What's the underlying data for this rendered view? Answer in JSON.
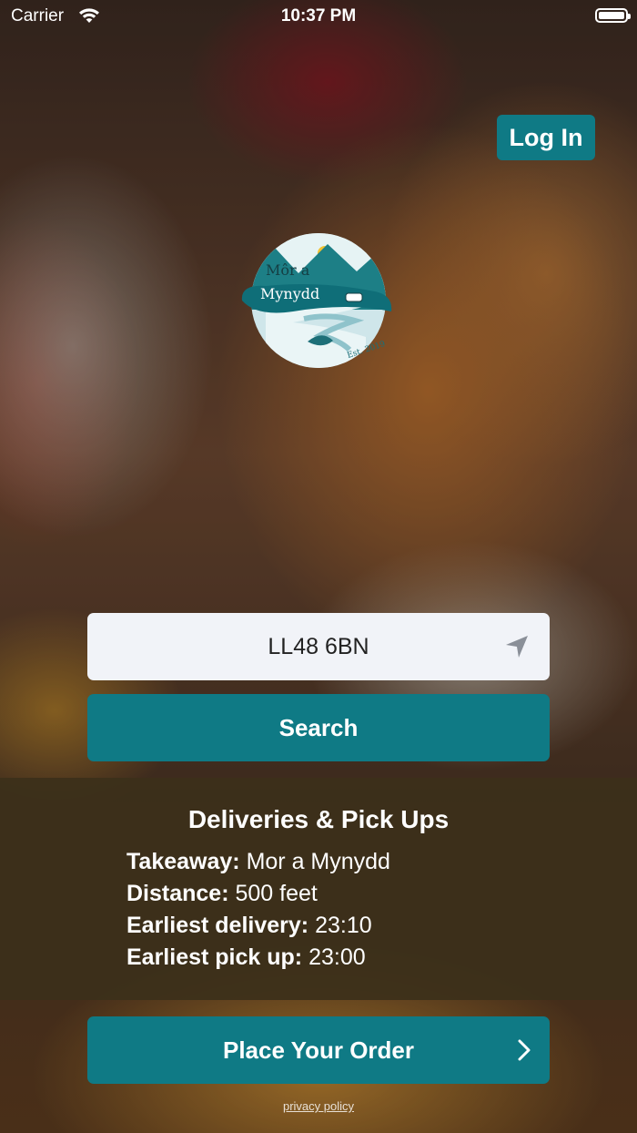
{
  "status_bar": {
    "carrier": "Carrier",
    "time": "10:37 PM"
  },
  "header": {
    "login_label": "Log In"
  },
  "logo": {
    "line1": "Môr a",
    "line2": "Mynydd",
    "est": "Est. 2019"
  },
  "search": {
    "postcode_value": "LL48 6BN",
    "search_label": "Search"
  },
  "info": {
    "title": "Deliveries & Pick Ups",
    "rows": [
      {
        "label": "Takeaway:",
        "value": "Mor a Mynydd"
      },
      {
        "label": "Distance:",
        "value": "500 feet"
      },
      {
        "label": "Earliest delivery:",
        "value": "23:10"
      },
      {
        "label": "Earliest pick up:",
        "value": "23:00"
      }
    ]
  },
  "order": {
    "label": "Place Your Order"
  },
  "footer": {
    "privacy_label": "privacy policy"
  },
  "colors": {
    "accent": "#0f7a85",
    "panel": "#3c301a",
    "logo_water": "#cfe6ea"
  }
}
